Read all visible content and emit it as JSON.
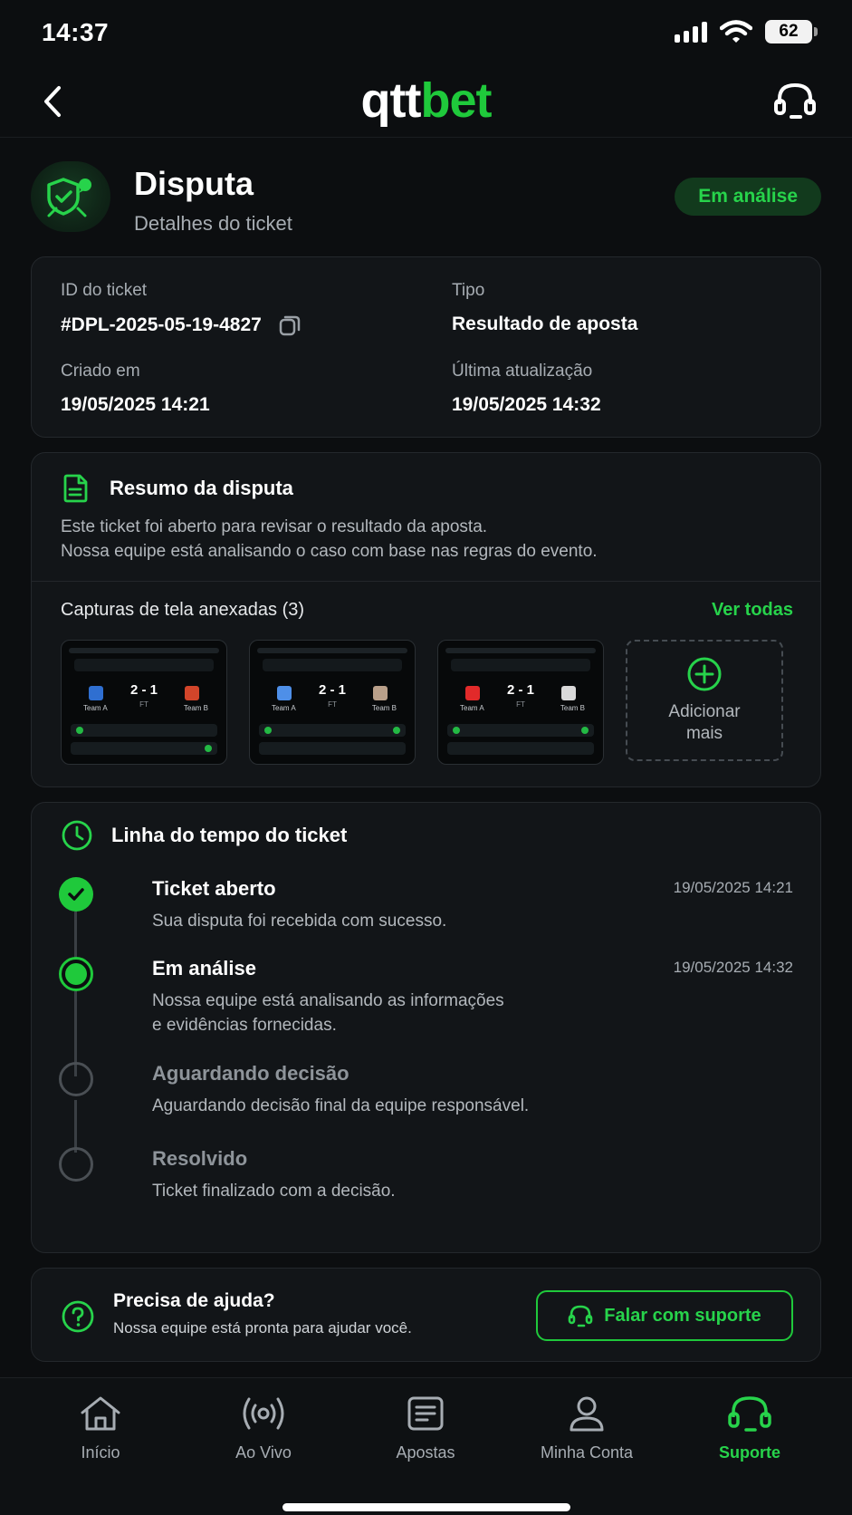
{
  "status_bar": {
    "time": "14:37",
    "battery": "62"
  },
  "header": {
    "logo_white": "qtt",
    "logo_green": "bet"
  },
  "title": {
    "heading": "Disputa",
    "subtitle": "Detalhes do ticket",
    "status": "Em análise"
  },
  "ticket_info": {
    "id_label": "ID do ticket",
    "id_value": "#DPL-2025-05-19-4827",
    "type_label": "Tipo",
    "type_value": "Resultado de aposta",
    "created_label": "Criado em",
    "created_value": "19/05/2025 14:21",
    "updated_label": "Última atualização",
    "updated_value": "19/05/2025 14:32"
  },
  "summary": {
    "title": "Resumo da disputa",
    "line1": "Este ticket foi aberto para revisar o resultado da aposta.",
    "line2": "Nossa equipe está analisando o caso com base nas regras do evento.",
    "attachments_title": "Capturas de tela anexadas (3)",
    "see_all": "Ver todas",
    "screenshots": [
      {
        "score": "2 - 1",
        "period": "FT",
        "team_a": "Team A",
        "team_b": "Team B",
        "crest_a": "#2f6fd1",
        "crest_b": "#d2452a"
      },
      {
        "score": "2 - 1",
        "period": "FT",
        "team_a": "Team A",
        "team_b": "Team B",
        "crest_a": "#4e8fe8",
        "crest_b": "#b9a08a"
      },
      {
        "score": "2 - 1",
        "period": "FT",
        "team_a": "Team A",
        "team_b": "Team B",
        "crest_a": "#e22a2a",
        "crest_b": "#d9d9d9"
      }
    ],
    "add_more": "Adicionar mais"
  },
  "timeline": {
    "title": "Linha do tempo do ticket",
    "items": [
      {
        "title": "Ticket aberto",
        "desc1": "Sua disputa foi recebida com sucesso.",
        "desc2": "",
        "date": "19/05/2025 14:21",
        "state": "done"
      },
      {
        "title": "Em análise",
        "desc1": "Nossa equipe está analisando as informações",
        "desc2": "e evidências fornecidas.",
        "date": "19/05/2025 14:32",
        "state": "active"
      },
      {
        "title": "Aguardando decisão",
        "desc1": "Aguardando decisão final da equipe responsável.",
        "desc2": "",
        "date": "",
        "state": "pending"
      },
      {
        "title": "Resolvido",
        "desc1": "Ticket finalizado com a decisão.",
        "desc2": "",
        "date": "",
        "state": "pending"
      }
    ]
  },
  "help": {
    "title": "Precisa de ajuda?",
    "text": "Nossa equipe está pronta para ajudar você.",
    "button": "Falar com suporte"
  },
  "nav": {
    "items": [
      {
        "label": "Início",
        "icon": "home-icon",
        "active": false
      },
      {
        "label": "Ao Vivo",
        "icon": "live-icon",
        "active": false
      },
      {
        "label": "Apostas",
        "icon": "bets-icon",
        "active": false
      },
      {
        "label": "Minha Conta",
        "icon": "user-icon",
        "active": false
      },
      {
        "label": "Suporte",
        "icon": "headset-icon",
        "active": true
      }
    ]
  },
  "colors": {
    "accent": "#1fc93b",
    "background": "#0c0e10",
    "card": "#121518"
  }
}
